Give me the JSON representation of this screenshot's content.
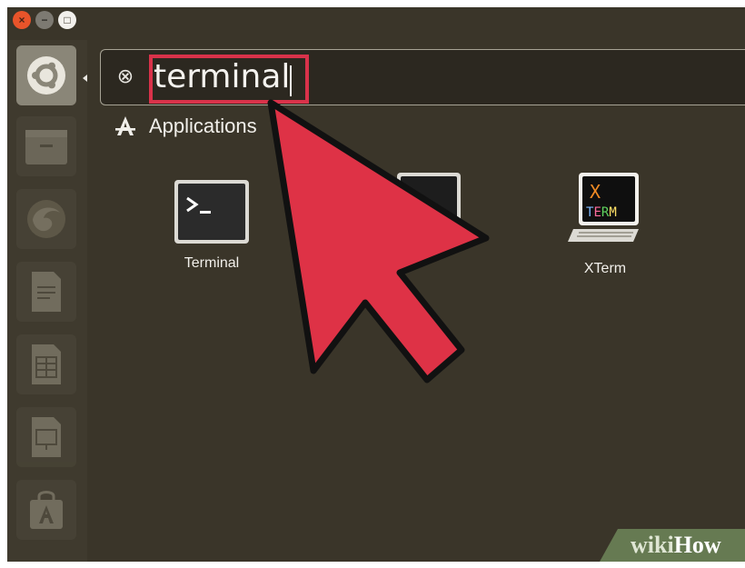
{
  "window": {
    "controls": {
      "close_icon": "close-icon",
      "minimize_icon": "minimize-icon",
      "maximize_icon": "maximize-icon"
    }
  },
  "launcher": {
    "items": [
      {
        "name": "ubuntu-logo",
        "active": true
      },
      {
        "name": "files"
      },
      {
        "name": "firefox"
      },
      {
        "name": "libreoffice-writer"
      },
      {
        "name": "libreoffice-calc"
      },
      {
        "name": "libreoffice-impress"
      },
      {
        "name": "software-center"
      }
    ]
  },
  "search": {
    "value": "terminal",
    "clear_icon": "clear-search-icon"
  },
  "category": {
    "label": "Applications",
    "icon": "applications-icon"
  },
  "results": [
    {
      "label": "Terminal",
      "icon": "terminal-icon"
    },
    {
      "label": "UXTerm",
      "visible_label": "rm",
      "icon": "uxterm-icon"
    },
    {
      "label": "XTerm",
      "icon": "xterm-icon",
      "icon_text_top": "X",
      "icon_text_bottom": "TERM"
    }
  ],
  "watermark": {
    "part1": "wiki",
    "part2": "How"
  },
  "colors": {
    "background": "#3a3529",
    "launcher": "#3f3a2e",
    "highlight": "#d9324a",
    "arrow": "#de3246",
    "text": "#f1efea"
  }
}
